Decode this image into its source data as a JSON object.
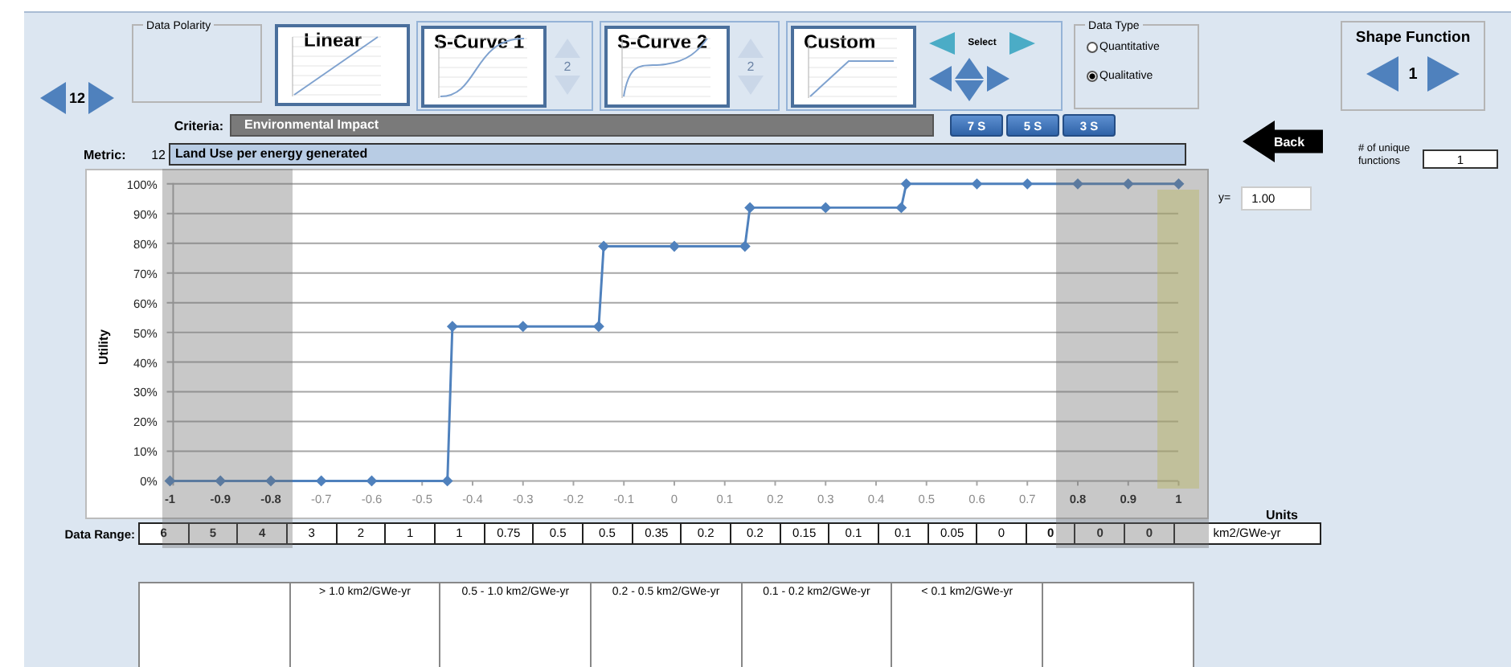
{
  "record_nav": {
    "value": "12"
  },
  "data_polarity": {
    "label": "Data Polarity"
  },
  "shape_tiles": [
    {
      "label": "Linear",
      "kind": "linear"
    },
    {
      "label": "S-Curve 1",
      "kind": "s_curve_1",
      "spinner": {
        "value": "2",
        "disabled": true
      }
    },
    {
      "label": "S-Curve 2",
      "kind": "s_curve_2",
      "spinner": {
        "value": "2",
        "disabled": true
      }
    },
    {
      "label": "Custom",
      "kind": "custom",
      "select_label": "Select"
    }
  ],
  "data_type": {
    "label": "Data Type",
    "options": [
      {
        "label": "Quantitative",
        "selected": false
      },
      {
        "label": "Qualitative",
        "selected": true
      }
    ]
  },
  "shape_function": {
    "title": "Shape Function",
    "value": "1"
  },
  "criteria": {
    "label": "Criteria:",
    "value": "Environmental Impact"
  },
  "scale_buttons": [
    "7 S",
    "5 S",
    "3 S"
  ],
  "back_button": "Back",
  "unique_functions": {
    "label": "# of unique functions",
    "value": "1"
  },
  "metric": {
    "label": "Metric:",
    "number": "12",
    "value": "Land Use per energy generated"
  },
  "chart": {
    "chart_data": {
      "type": "line",
      "ylabel": "Utility",
      "x": [
        -1,
        -0.9,
        -0.8,
        -0.7,
        -0.6,
        -0.45,
        -0.44,
        -0.3,
        -0.15,
        -0.14,
        0,
        0.14,
        0.15,
        0.3,
        0.45,
        0.46,
        0.6,
        0.7,
        0.8,
        0.9,
        1
      ],
      "grid": true,
      "series": [
        {
          "color": "#4f81bd",
          "marker": "diamond",
          "values": [
            0,
            0,
            0,
            0,
            0,
            0,
            0.52,
            0.52,
            0.52,
            0.79,
            0.79,
            0.79,
            0.92,
            0.92,
            0.92,
            1,
            1,
            1,
            1,
            1,
            1
          ]
        }
      ],
      "xlim": [
        -1,
        1
      ],
      "ylim": [
        0,
        1
      ],
      "xticks": [
        -1,
        -0.9,
        -0.8,
        -0.7,
        -0.6,
        -0.5,
        -0.4,
        -0.3,
        -0.2,
        -0.1,
        0,
        0.1,
        0.2,
        0.3,
        0.4,
        0.5,
        0.6,
        0.7,
        0.8,
        0.9,
        1
      ],
      "yticks": [
        {
          "value": 0,
          "label": "0%"
        },
        {
          "value": 0.1,
          "label": "10%"
        },
        {
          "value": 0.2,
          "label": "20%"
        },
        {
          "value": 0.3,
          "label": "30%"
        },
        {
          "value": 0.4,
          "label": "40%"
        },
        {
          "value": 0.5,
          "label": "50%"
        },
        {
          "value": 0.6,
          "label": "60%"
        },
        {
          "value": 0.7,
          "label": "70%"
        },
        {
          "value": 0.8,
          "label": "80%"
        },
        {
          "value": 0.9,
          "label": "90%"
        },
        {
          "value": 1,
          "label": "100%"
        }
      ]
    }
  },
  "y_value": {
    "label": "y=",
    "value": "1.00"
  },
  "units": {
    "label": "Units",
    "value": "km2/GWe-yr"
  },
  "data_range": {
    "label": "Data Range:",
    "cells": [
      {
        "value": "6",
        "disabled": true,
        "selected": false
      },
      {
        "value": "5",
        "disabled": true,
        "selected": false
      },
      {
        "value": "4",
        "disabled": true,
        "selected": false
      },
      {
        "value": "3",
        "disabled": false,
        "selected": false
      },
      {
        "value": "2",
        "disabled": false,
        "selected": false
      },
      {
        "value": "1",
        "disabled": false,
        "selected": false
      },
      {
        "value": "1",
        "disabled": false,
        "selected": false
      },
      {
        "value": "0.75",
        "disabled": false,
        "selected": false
      },
      {
        "value": "0.5",
        "disabled": false,
        "selected": false
      },
      {
        "value": "0.5",
        "disabled": false,
        "selected": false
      },
      {
        "value": "0.35",
        "disabled": false,
        "selected": false
      },
      {
        "value": "0.2",
        "disabled": false,
        "selected": false
      },
      {
        "value": "0.2",
        "disabled": false,
        "selected": false
      },
      {
        "value": "0.15",
        "disabled": false,
        "selected": false
      },
      {
        "value": "0.1",
        "disabled": false,
        "selected": false
      },
      {
        "value": "0.1",
        "disabled": false,
        "selected": false
      },
      {
        "value": "0.05",
        "disabled": false,
        "selected": false
      },
      {
        "value": "0",
        "disabled": false,
        "selected": false
      },
      {
        "value": "0",
        "disabled": true,
        "selected": false
      },
      {
        "value": "0",
        "disabled": true,
        "selected": false
      },
      {
        "value": "0",
        "disabled": true,
        "selected": true
      }
    ]
  },
  "range_descriptions": [
    {
      "kind": "empty"
    },
    {
      "kind": "text",
      "text": "> 1.0 km2/GWe-yr"
    },
    {
      "kind": "text",
      "text": "0.5 - 1.0 km2/GWe-yr"
    },
    {
      "kind": "text",
      "text": "0.2 - 0.5 km2/GWe-yr"
    },
    {
      "kind": "text",
      "text": "0.1 - 0.2 km2/GWe-yr"
    },
    {
      "kind": "text",
      "text": "< 0.1 km2/GWe-yr"
    },
    {
      "kind": "empty"
    }
  ]
}
